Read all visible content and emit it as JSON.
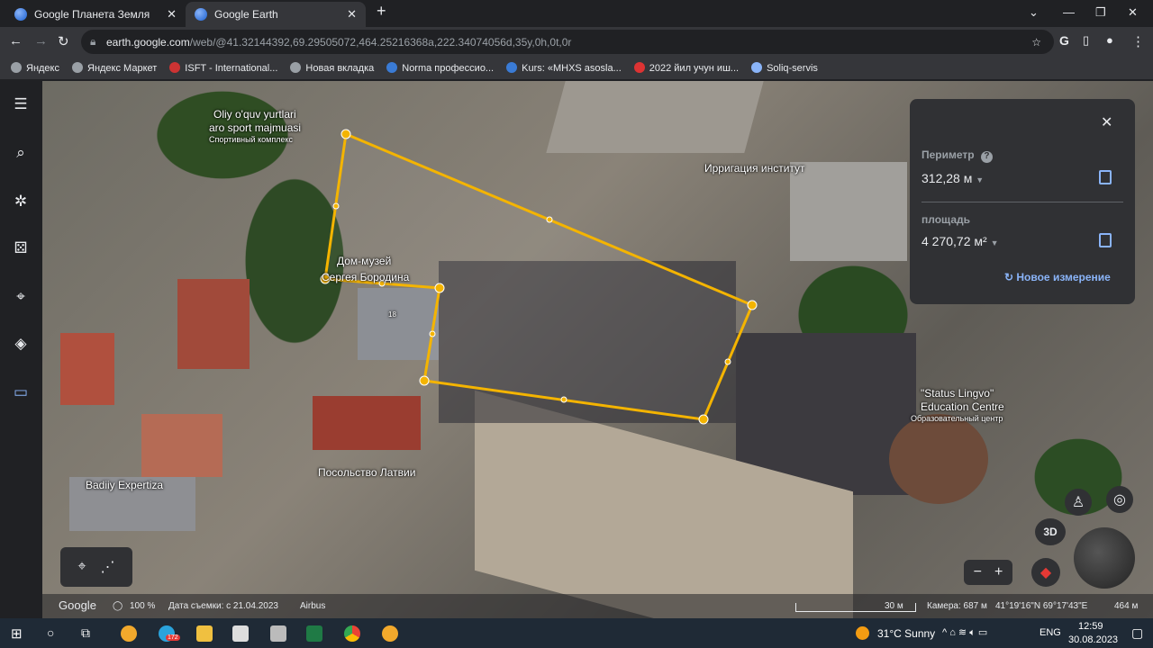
{
  "browser": {
    "tabs": [
      {
        "title": "Google Планета Земля"
      },
      {
        "title": "Google Earth"
      }
    ],
    "url_host": "earth.google.com",
    "url_path": "/web/@41.32144392,69.29505072,464.25216368a,222.34074056d,35y,0h,0t,0r",
    "bookmarks": [
      "Яндекс",
      "Яндекс Маркет",
      "ISFT - International...",
      "Новая вкладка",
      "Norma профессио...",
      "Kurs: «MHXS asosla...",
      "2022 йил учун иш...",
      "Soliq-servis"
    ]
  },
  "map_labels": {
    "sport1": "Oliy o'quv yurtlari",
    "sport2": "aro sport majmuasi",
    "sport3": "Спортивный комплекс",
    "irrigation": "Ирригация институт",
    "museum1": "Дом-музей",
    "museum2": "Сергея Бородина",
    "house": "18",
    "lingvo1": "\"Status Lingvo\"",
    "lingvo2": "Education Centre",
    "lingvo3": "Образовательный центр",
    "expertiza": "Badiiy Expertiza",
    "embassy": "Посольство Латвии"
  },
  "measure": {
    "perimeter_label": "Периметр",
    "perimeter_value": "312,28 м",
    "area_label": "площадь",
    "area_value": "4 270,72 м²",
    "new_label": "Новое измерение",
    "polygon_color": "#f4b400"
  },
  "controls": {
    "view3d": "3D"
  },
  "status": {
    "logo": "Google",
    "percent": "100 %",
    "date": "Дата съемки: с 21.04.2023",
    "provider": "Airbus",
    "scale": "30 м",
    "camera": "Камера: 687 м",
    "coords": "41°19'16\"N 69°17'43\"E",
    "elevation": "464 м"
  },
  "taskbar": {
    "weather": "31°C  Sunny",
    "lang": "ENG",
    "time": "12:59",
    "date": "30.08.2023",
    "telegram_badge": "172"
  }
}
